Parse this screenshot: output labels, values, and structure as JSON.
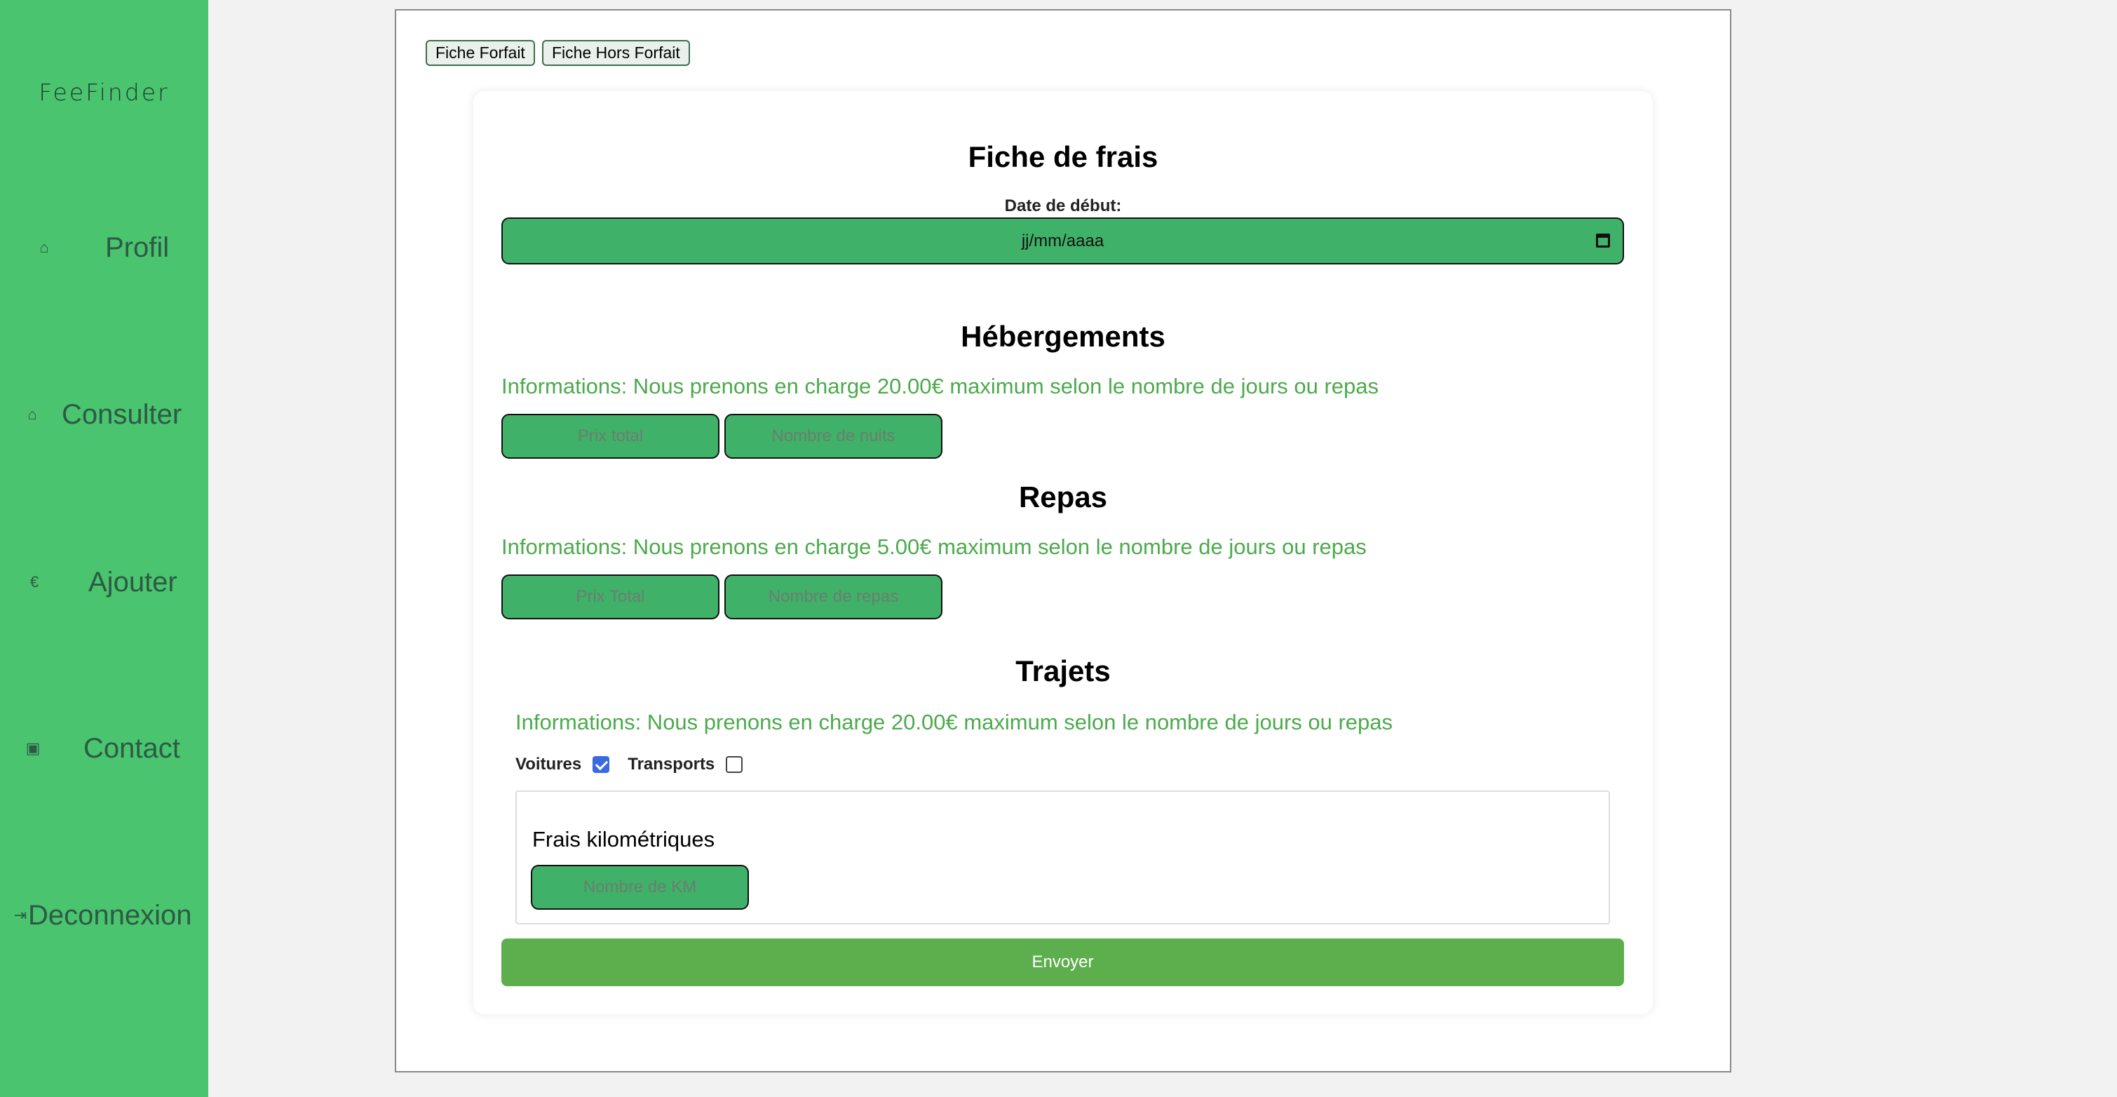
{
  "sidebar": {
    "logo": "FeeFinder",
    "items": [
      {
        "label": "Profil",
        "icon": "home-icon"
      },
      {
        "label": "Consulter",
        "icon": "home-icon"
      },
      {
        "label": "Ajouter",
        "icon": "euro-icon"
      },
      {
        "label": "Contact",
        "icon": "contact-book-icon"
      },
      {
        "label": "Deconnexion",
        "icon": "logout-icon"
      }
    ]
  },
  "tabs": [
    {
      "label": "Fiche Forfait"
    },
    {
      "label": "Fiche Hors Forfait"
    }
  ],
  "form": {
    "title": "Fiche de frais",
    "date_label": "Date de début:",
    "date_placeholder": "jj/mm/aaaa",
    "hebergements": {
      "title": "Hébergements",
      "info": "Informations: Nous prenons en charge 20.00€ maximum selon le nombre de jours ou repas",
      "price_placeholder": "Prix total",
      "count_placeholder": "Nombre de nuits"
    },
    "repas": {
      "title": "Repas",
      "info": "Informations: Nous prenons en charge 5.00€ maximum selon le nombre de jours ou repas",
      "price_placeholder": "Prix Total",
      "count_placeholder": "Nombre de repas"
    },
    "trajets": {
      "title": "Trajets",
      "info": "Informations: Nous prenons en charge 20.00€ maximum selon le nombre de jours ou repas",
      "voitures_label": "Voitures",
      "voitures_checked": true,
      "transports_label": "Transports",
      "transports_checked": false,
      "km_title": "Frais kilométriques",
      "km_placeholder": "Nombre de KM"
    },
    "submit_label": "Envoyer"
  },
  "colors": {
    "sidebar_bg": "#4ac46f",
    "input_bg": "#3fb168",
    "info_text": "#4caa4c",
    "submit_bg": "#5caf4c",
    "checkbox_on": "#3a6ae0"
  }
}
